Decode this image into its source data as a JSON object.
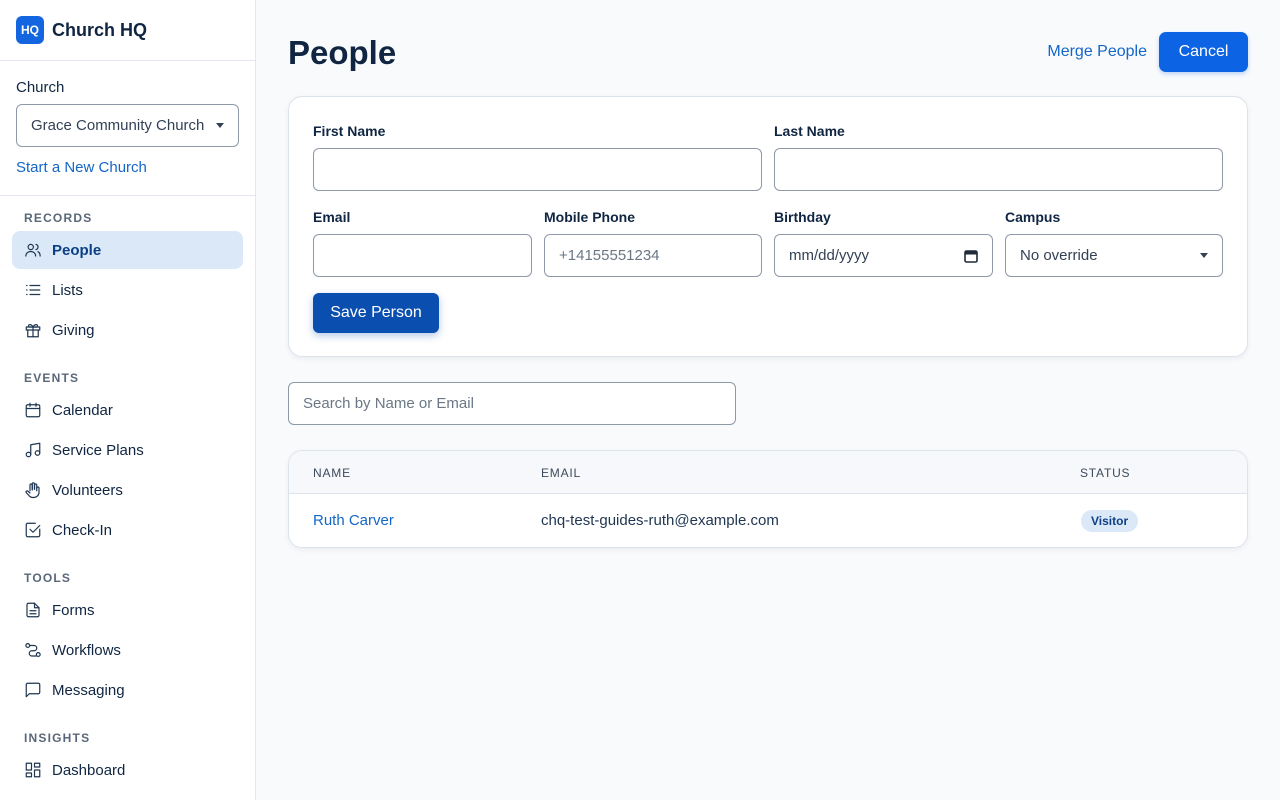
{
  "brand": {
    "logo": "HQ",
    "name": "Church HQ"
  },
  "church": {
    "label": "Church",
    "selected": "Grace Community Church",
    "new_link": "Start a New Church"
  },
  "nav": {
    "records": {
      "heading": "RECORDS",
      "items": [
        "People",
        "Lists",
        "Giving"
      ]
    },
    "events": {
      "heading": "EVENTS",
      "items": [
        "Calendar",
        "Service Plans",
        "Volunteers",
        "Check-In"
      ]
    },
    "tools": {
      "heading": "TOOLS",
      "items": [
        "Forms",
        "Workflows",
        "Messaging"
      ]
    },
    "insights": {
      "heading": "INSIGHTS",
      "items": [
        "Dashboard"
      ]
    }
  },
  "header": {
    "title": "People",
    "merge_label": "Merge People",
    "cancel_label": "Cancel"
  },
  "form": {
    "first_name_label": "First Name",
    "last_name_label": "Last Name",
    "email_label": "Email",
    "phone_label": "Mobile Phone",
    "phone_placeholder": "+14155551234",
    "birthday_label": "Birthday",
    "birthday_placeholder": "mm/dd/yyyy",
    "campus_label": "Campus",
    "campus_value": "No override",
    "save_label": "Save Person"
  },
  "search": {
    "placeholder": "Search by Name or Email"
  },
  "table": {
    "columns": [
      "NAME",
      "EMAIL",
      "STATUS"
    ],
    "rows": [
      {
        "name": "Ruth Carver",
        "email": "chq-test-guides-ruth@example.com",
        "status": "Visitor"
      }
    ]
  },
  "colors": {
    "accent": "#0c63e4",
    "primary_dark": "#0a4fb0",
    "link": "#1466c8",
    "active_bg": "#dbe8f8"
  }
}
